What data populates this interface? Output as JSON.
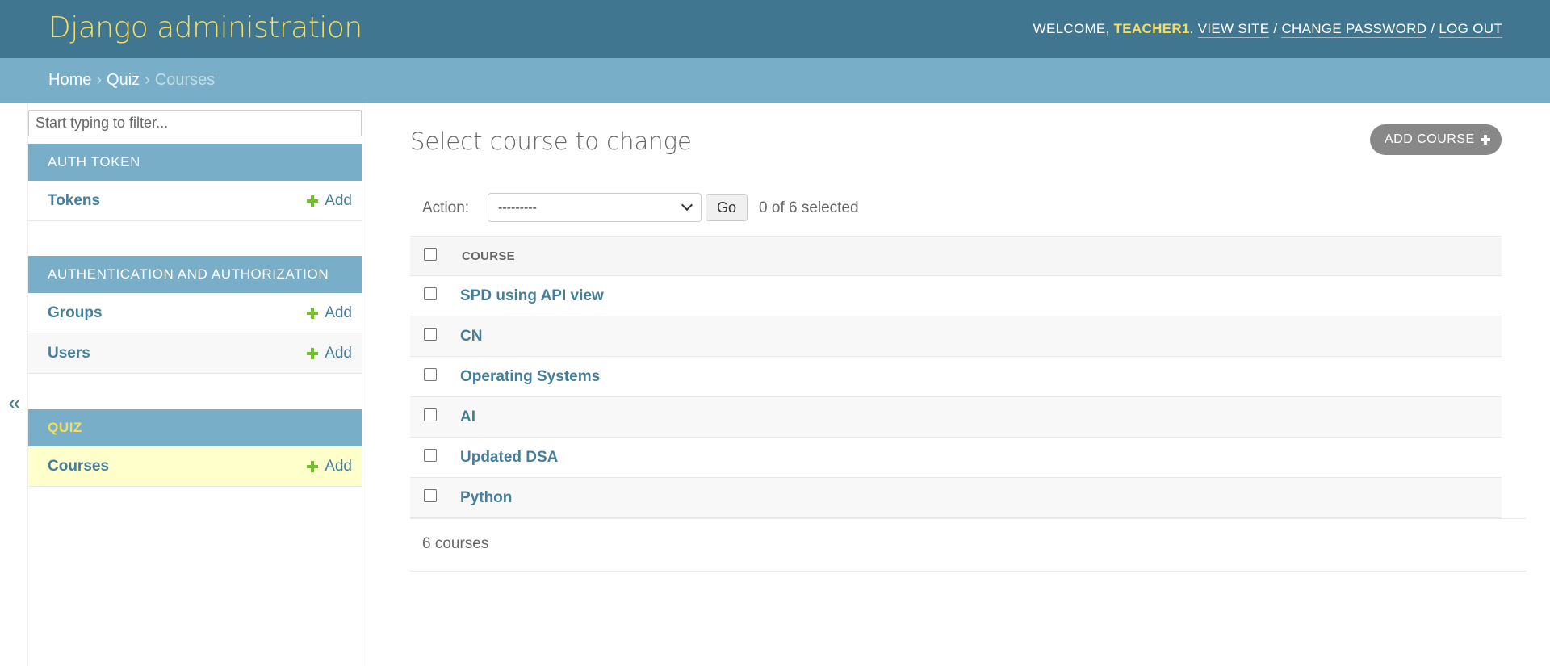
{
  "header": {
    "branding": "Django administration",
    "welcome": "Welcome,",
    "username": "teacher1",
    "view_site": "View site",
    "change_password": "Change password",
    "log_out": "Log out"
  },
  "breadcrumbs": {
    "home": "Home",
    "app": "Quiz",
    "current": "Courses",
    "separator": "›"
  },
  "sidebar": {
    "toggle": "«",
    "filter_placeholder": "Start typing to filter...",
    "modules": [
      {
        "caption": "Auth Token",
        "rows": [
          {
            "label": "Tokens",
            "add": "Add"
          }
        ]
      },
      {
        "caption": "Authentication and Authorization",
        "rows": [
          {
            "label": "Groups",
            "add": "Add"
          },
          {
            "label": "Users",
            "add": "Add"
          }
        ]
      },
      {
        "caption": "Quiz",
        "rows": [
          {
            "label": "Courses",
            "add": "Add"
          }
        ]
      }
    ]
  },
  "content": {
    "title": "Select course to change",
    "add_button": "Add course",
    "action_label": "Action:",
    "action_select_value": "---------",
    "go_button": "Go",
    "selection_counter": "0 of 6 selected",
    "column_header": "Course",
    "rows": [
      "SPD using API view",
      "CN",
      "Operating Systems",
      "AI",
      "Updated DSA",
      "Python"
    ],
    "paginator": "6 courses"
  },
  "colors": {
    "header_bg": "#417690",
    "breadcrumb_bg": "#79aec8",
    "accent_yellow": "#f5dd5d",
    "link": "#447e9b",
    "add_green": "#70bf2b",
    "active_row": "#ffffcc"
  }
}
